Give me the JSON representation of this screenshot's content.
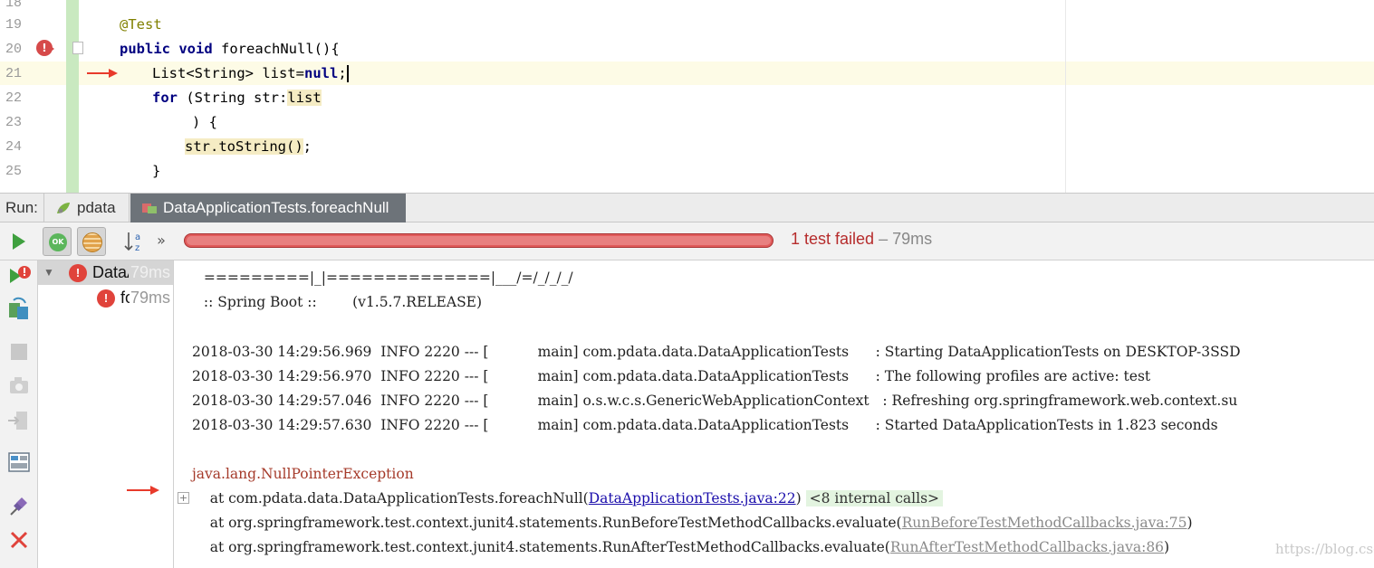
{
  "editor": {
    "line_numbers": [
      "18",
      "19",
      "20",
      "21",
      "22",
      "23",
      "24",
      "25"
    ],
    "code": {
      "annotation": "@Test",
      "line20": {
        "kw1": "public",
        "kw2": "void",
        "rest": "foreachNull(){"
      },
      "line21": {
        "type": "List<String>",
        "var": " list=",
        "kw": "null",
        "semi": ";"
      },
      "line22": {
        "kw": "for",
        "rest": " (String str:",
        "var": "list"
      },
      "line23": ") {",
      "line24": {
        "call": "str.toString()",
        "semi": ";"
      },
      "line25": "}"
    }
  },
  "run_panel": {
    "label": "Run:",
    "tabs": [
      {
        "label": "pdata",
        "icon": "spring-run-icon",
        "active": false
      },
      {
        "label": "DataApplicationTests.foreachNull",
        "icon": "test-config-icon",
        "active": true
      }
    ]
  },
  "toolbar": {
    "ok_label": "OK",
    "sort_label": "a z",
    "more": "»",
    "progress": 1.0,
    "status_failed": "1 test failed",
    "status_time": " – 79ms",
    "colors": {
      "failed": "#b62c2c",
      "progress": "#e05b5b"
    }
  },
  "test_tree": [
    {
      "name": "DataApplicationTests",
      "time": "79ms",
      "status": "error",
      "selected": true
    },
    {
      "name": "foreachNull",
      "time": "79ms",
      "status": "error",
      "selected": false
    }
  ],
  "console": {
    "banner1": " =========|_|==============|___/=/_/_/_/",
    "banner2": " :: Spring Boot ::        (v1.5.7.RELEASE)",
    "logs": [
      "2018-03-30 14:29:56.969  INFO 2220 --- [           main] com.pdata.data.DataApplicationTests      : Starting DataApplicationTests on DESKTOP-3SSD",
      "2018-03-30 14:29:56.970  INFO 2220 --- [           main] com.pdata.data.DataApplicationTests      : The following profiles are active: test",
      "2018-03-30 14:29:57.046  INFO 2220 --- [           main] o.s.w.c.s.GenericWebApplicationContext   : Refreshing org.springframework.web.context.su",
      "2018-03-30 14:29:57.630  INFO 2220 --- [           main] com.pdata.data.DataApplicationTests      : Started DataApplicationTests in 1.823 seconds"
    ],
    "exception": "java.lang.NullPointerException",
    "stack": [
      {
        "prefix": "    at com.pdata.data.DataApplicationTests.foreachNull(",
        "link": "DataApplicationTests.java:22",
        "suffix": ") ",
        "calls": "<8 internal calls>"
      },
      {
        "prefix": "    at org.springframework.test.context.junit4.statements.RunBeforeTestMethodCallbacks.evaluate(",
        "link": "RunBeforeTestMethodCallbacks.java:75",
        "suffix": ")"
      },
      {
        "prefix": "    at org.springframework.test.context.junit4.statements.RunAfterTestMethodCallbacks.evaluate(",
        "link": "RunAfterTestMethodCallbacks.java:86",
        "suffix": ")"
      }
    ],
    "watermark": "https://blog.csdn.net/csdn_am"
  }
}
